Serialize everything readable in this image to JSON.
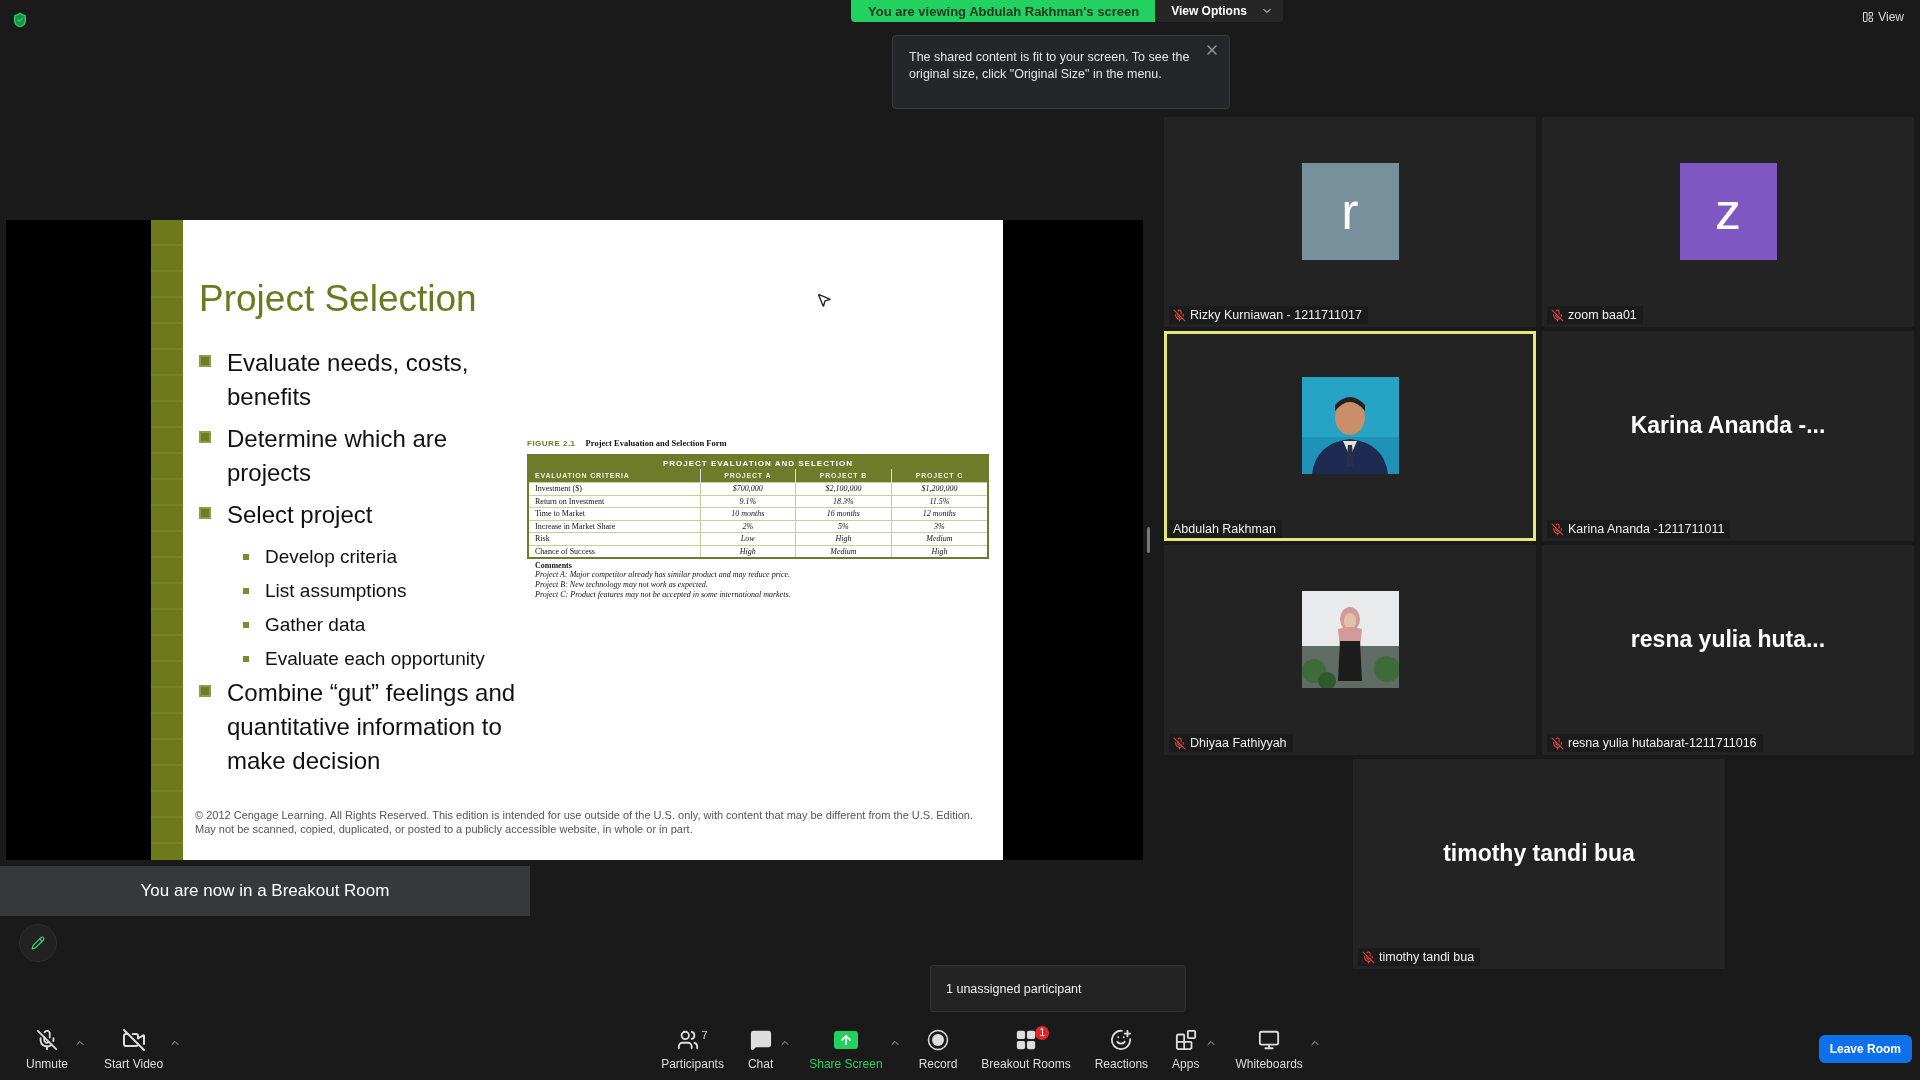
{
  "share_banner": {
    "viewing": "You are viewing Abdulah Rakhman's screen",
    "view_options": "View Options"
  },
  "tooltip": {
    "text": "The shared content is fit to your screen. To see the original size, click \"Original Size\" in the menu."
  },
  "view_button": "View",
  "slide": {
    "title": "Project Selection",
    "bullets": [
      {
        "text": "Evaluate needs, costs, benefits"
      },
      {
        "text": "Determine which are projects"
      },
      {
        "text": "Select project",
        "children": [
          {
            "text": "Develop criteria"
          },
          {
            "text": "List assumptions"
          },
          {
            "text": "Gather data"
          },
          {
            "text": "Evaluate each opportunity"
          }
        ]
      },
      {
        "text": "Combine “gut” feelings and quantitative information to make decision"
      }
    ],
    "figure": {
      "label": "FIGURE 2.1",
      "caption": "Project Evaluation and Selection Form",
      "table_title": "PROJECT EVALUATION AND SELECTION",
      "columns": [
        "EVALUATION CRITERIA",
        "PROJECT A",
        "PROJECT B",
        "PROJECT C"
      ],
      "rows": [
        [
          "Investment ($)",
          "$700,000",
          "$2,100,000",
          "$1,200,000"
        ],
        [
          "Return on Investment",
          "9.1%",
          "18.3%",
          "11.5%"
        ],
        [
          "Time to Market",
          "10 months",
          "16 months",
          "12 months"
        ],
        [
          "Increase in Market Share",
          "2%",
          "5%",
          "3%"
        ],
        [
          "Risk",
          "Low",
          "High",
          "Medium"
        ],
        [
          "Chance of Success",
          "High",
          "Medium",
          "High"
        ]
      ],
      "comments_label": "Comments",
      "comments": [
        "Project A: Major competitor already has similar product and may reduce price.",
        "Project B: New technology may not work as expected.",
        "Project C: Product features may not be accepted in some international markets."
      ]
    },
    "footer": "© 2012 Cengage Learning. All Rights Reserved. This edition is intended for use outside of the U.S. only, with content that may be different from the U.S. Edition. May not be scanned, copied, duplicated, or posted to a publicly accessible website, in whole or in part."
  },
  "breakout_notice": "You are now in a Breakout Room",
  "participants": [
    {
      "name": "Rizky Kurniawan - 1211711017",
      "kind": "letter",
      "avatar": "r",
      "color": "#78909c",
      "muted": true,
      "active": false
    },
    {
      "name": "zoom baa01",
      "kind": "letter",
      "avatar": "z",
      "color": "#7e57c2",
      "muted": true,
      "active": false
    },
    {
      "name": "Abdulah Rakhman",
      "muted": false,
      "active": true
    },
    {
      "name": "Karina Ananda -1211711011",
      "kind": "text",
      "display": "Karina Ananda -...",
      "muted": true,
      "active": false
    },
    {
      "name": "Dhiyaa Fathiyyah",
      "muted": true,
      "active": false
    },
    {
      "name": "resna yulia hutabarat-1211711016",
      "kind": "text",
      "display": "resna yulia huta...",
      "muted": true,
      "active": false
    },
    {
      "name": "timothy tandi bua",
      "kind": "text",
      "display": "timothy tandi bua",
      "muted": true,
      "active": false
    }
  ],
  "unassigned_popup": "1 unassigned participant",
  "toolbar": [
    {
      "label": "Unmute",
      "caret": true
    },
    {
      "label": "Start Video",
      "caret": true
    },
    {
      "label": "Participants",
      "caret": false,
      "count": "7"
    },
    {
      "label": "Chat",
      "caret": true
    },
    {
      "label": "Share Screen",
      "caret": true,
      "accent": true
    },
    {
      "label": "Record",
      "caret": false
    },
    {
      "label": "Breakout Rooms",
      "caret": false,
      "badge": "1"
    },
    {
      "label": "Reactions",
      "caret": false
    },
    {
      "label": "Apps",
      "caret": true
    },
    {
      "label": "Whiteboards",
      "caret": true
    }
  ],
  "leave_button": "Leave Room"
}
